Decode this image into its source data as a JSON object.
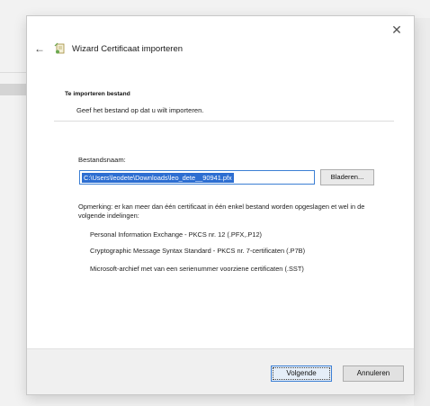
{
  "dialog": {
    "title": "Wizard Certificaat importeren",
    "close_glyph": "✕",
    "back_glyph": "←",
    "section_title": "Te importeren bestand",
    "section_desc": "Geef het bestand op dat u wilt importeren.",
    "file_label": "Bestandsnaam:",
    "file_value": "C:\\Users\\leodete\\Downloads\\leo_dete__90941.pfx",
    "browse_label": "Bladeren...",
    "note": "Opmerking: er kan meer dan één certificaat in één enkel bestand worden opgeslagen et wel in de volgende indelingen:",
    "formats": [
      "Personal Information Exchange - PKCS nr. 12 (.PFX,.P12)",
      "Cryptographic Message Syntax Standard - PKCS nr. 7-certificaten (.P7B)",
      "Microsoft-archief met van een serienummer voorziene certificaten (.SST)"
    ],
    "next_label": "Volgende",
    "cancel_label": "Annuleren"
  },
  "icons": {
    "back": "back-arrow-icon",
    "wizard": "certificate-wizard-icon",
    "close": "close-icon"
  },
  "colors": {
    "selection": "#2d6ed1",
    "focus_border": "#3c7fd4"
  }
}
